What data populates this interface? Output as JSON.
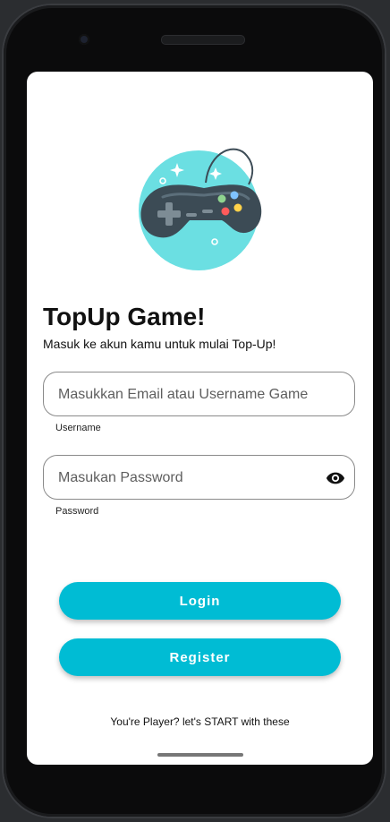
{
  "app": {
    "title": "TopUp Game!",
    "subtitle": "Masuk ke akun kamu untuk mulai Top-Up!"
  },
  "form": {
    "username": {
      "placeholder": "Masukkan Email atau Username Game",
      "value": "",
      "label": "Username"
    },
    "password": {
      "placeholder": "Masukan Password",
      "value": "",
      "label": "Password",
      "toggle_icon": "eye-icon"
    }
  },
  "buttons": {
    "login": "Login",
    "register": "Register"
  },
  "footer": {
    "text": "You're Player? let's START with these"
  },
  "colors": {
    "accent": "#00bcd4",
    "logo_bg": "#6bdfe2",
    "controller": "#3c4b55"
  },
  "icons": {
    "logo": "gamepad-icon"
  }
}
